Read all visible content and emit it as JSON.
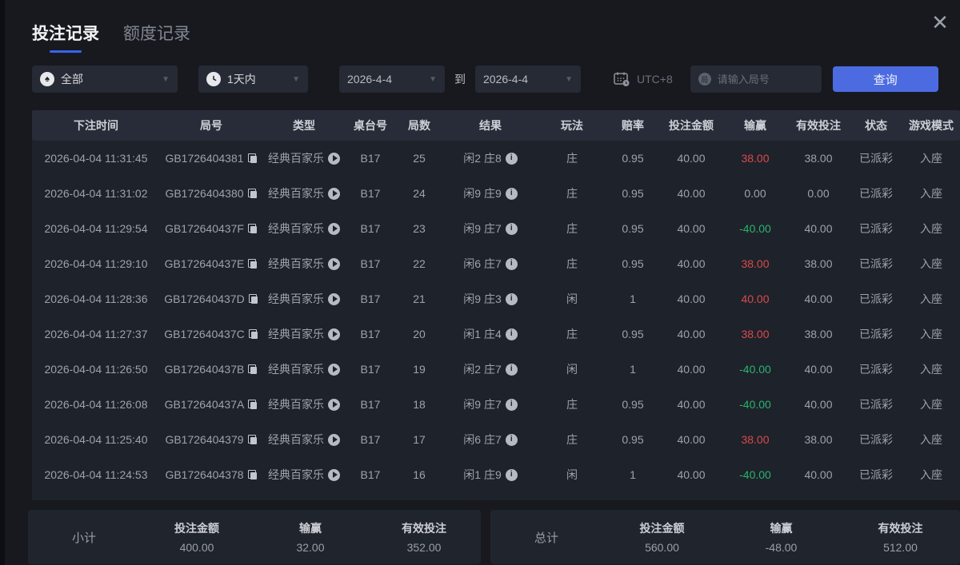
{
  "tabs": {
    "bet_records": "投注记录",
    "quota_records": "额度记录"
  },
  "filters": {
    "game_type_value": "全部",
    "time_range_value": "1天内",
    "date_from": "2026-4-4",
    "to_label": "到",
    "date_to": "2026-4-4",
    "timezone": "UTC+8",
    "round_placeholder": "请输入局号",
    "query_label": "查询"
  },
  "table": {
    "columns": [
      "下注时间",
      "局号",
      "类型",
      "桌台号",
      "局数",
      "结果",
      "玩法",
      "赔率",
      "投注金额",
      "输赢",
      "有效投注",
      "状态",
      "游戏模式"
    ],
    "rows": [
      {
        "time": "2026-04-04 11:31:45",
        "round_id": "GB1726404381",
        "type": "经典百家乐",
        "table_no": "B17",
        "round_no": "25",
        "result": "闲2 庄8",
        "play": "庄",
        "odds": "0.95",
        "bet": "40.00",
        "winloss": "38.00",
        "winloss_color": "red",
        "valid": "38.00",
        "status": "已派彩",
        "mode": "入座"
      },
      {
        "time": "2026-04-04 11:31:02",
        "round_id": "GB1726404380",
        "type": "经典百家乐",
        "table_no": "B17",
        "round_no": "24",
        "result": "闲9 庄9",
        "play": "庄",
        "odds": "0.95",
        "bet": "40.00",
        "winloss": "0.00",
        "winloss_color": "",
        "valid": "0.00",
        "status": "已派彩",
        "mode": "入座"
      },
      {
        "time": "2026-04-04 11:29:54",
        "round_id": "GB172640437F",
        "type": "经典百家乐",
        "table_no": "B17",
        "round_no": "23",
        "result": "闲9 庄7",
        "play": "庄",
        "odds": "0.95",
        "bet": "40.00",
        "winloss": "-40.00",
        "winloss_color": "green",
        "valid": "40.00",
        "status": "已派彩",
        "mode": "入座"
      },
      {
        "time": "2026-04-04 11:29:10",
        "round_id": "GB172640437E",
        "type": "经典百家乐",
        "table_no": "B17",
        "round_no": "22",
        "result": "闲6 庄7",
        "play": "庄",
        "odds": "0.95",
        "bet": "40.00",
        "winloss": "38.00",
        "winloss_color": "red",
        "valid": "38.00",
        "status": "已派彩",
        "mode": "入座"
      },
      {
        "time": "2026-04-04 11:28:36",
        "round_id": "GB172640437D",
        "type": "经典百家乐",
        "table_no": "B17",
        "round_no": "21",
        "result": "闲9 庄3",
        "play": "闲",
        "odds": "1",
        "bet": "40.00",
        "winloss": "40.00",
        "winloss_color": "red",
        "valid": "40.00",
        "status": "已派彩",
        "mode": "入座"
      },
      {
        "time": "2026-04-04 11:27:37",
        "round_id": "GB172640437C",
        "type": "经典百家乐",
        "table_no": "B17",
        "round_no": "20",
        "result": "闲1 庄4",
        "play": "庄",
        "odds": "0.95",
        "bet": "40.00",
        "winloss": "38.00",
        "winloss_color": "red",
        "valid": "38.00",
        "status": "已派彩",
        "mode": "入座"
      },
      {
        "time": "2026-04-04 11:26:50",
        "round_id": "GB172640437B",
        "type": "经典百家乐",
        "table_no": "B17",
        "round_no": "19",
        "result": "闲2 庄7",
        "play": "闲",
        "odds": "1",
        "bet": "40.00",
        "winloss": "-40.00",
        "winloss_color": "green",
        "valid": "40.00",
        "status": "已派彩",
        "mode": "入座"
      },
      {
        "time": "2026-04-04 11:26:08",
        "round_id": "GB172640437A",
        "type": "经典百家乐",
        "table_no": "B17",
        "round_no": "18",
        "result": "闲9 庄7",
        "play": "庄",
        "odds": "0.95",
        "bet": "40.00",
        "winloss": "-40.00",
        "winloss_color": "green",
        "valid": "40.00",
        "status": "已派彩",
        "mode": "入座"
      },
      {
        "time": "2026-04-04 11:25:40",
        "round_id": "GB1726404379",
        "type": "经典百家乐",
        "table_no": "B17",
        "round_no": "17",
        "result": "闲6 庄7",
        "play": "庄",
        "odds": "0.95",
        "bet": "40.00",
        "winloss": "38.00",
        "winloss_color": "red",
        "valid": "38.00",
        "status": "已派彩",
        "mode": "入座"
      },
      {
        "time": "2026-04-04 11:24:53",
        "round_id": "GB1726404378",
        "type": "经典百家乐",
        "table_no": "B17",
        "round_no": "16",
        "result": "闲1 庄9",
        "play": "闲",
        "odds": "1",
        "bet": "40.00",
        "winloss": "-40.00",
        "winloss_color": "green",
        "valid": "40.00",
        "status": "已派彩",
        "mode": "入座"
      }
    ]
  },
  "summary": {
    "subtotal": {
      "label": "小计",
      "bet_label": "投注金额",
      "bet": "400.00",
      "winloss_label": "输赢",
      "winloss": "32.00",
      "winloss_color": "red",
      "valid_label": "有效投注",
      "valid": "352.00"
    },
    "total": {
      "label": "总计",
      "bet_label": "投注金额",
      "bet": "560.00",
      "winloss_label": "输赢",
      "winloss": "-48.00",
      "winloss_color": "green",
      "valid_label": "有效投注",
      "valid": "512.00"
    }
  },
  "colors": {
    "win_red": "#d94b4b",
    "loss_green": "#27b56d",
    "accent_blue": "#4d6be0",
    "tab_underline": "#3a63f0"
  }
}
